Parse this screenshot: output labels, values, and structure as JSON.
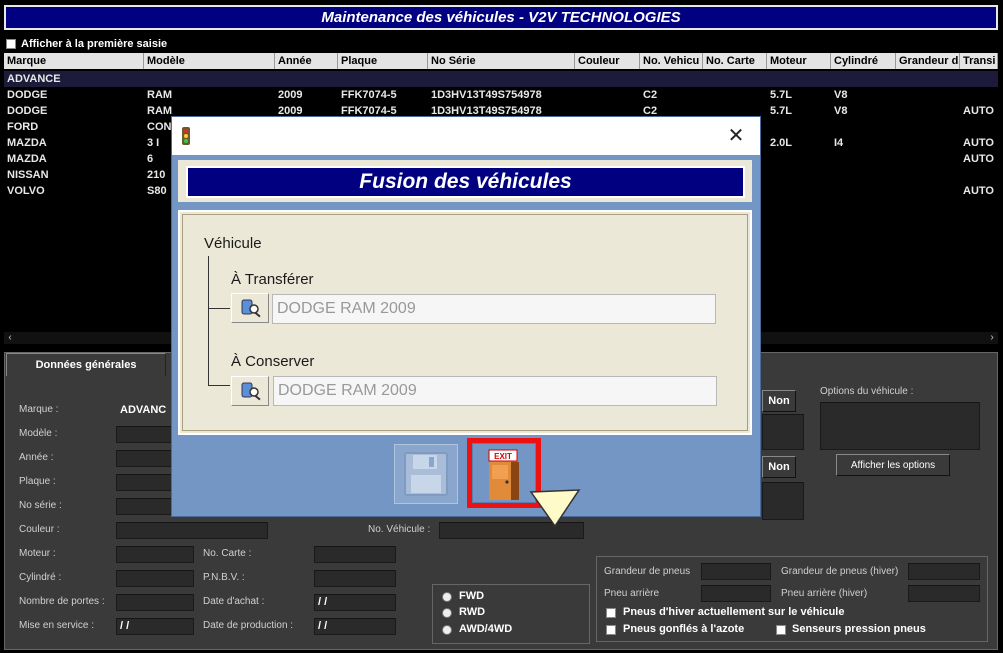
{
  "app": {
    "title": "Maintenance des véhicules - V2V TECHNOLOGIES"
  },
  "show_first": {
    "label": "Afficher à la première saisie"
  },
  "grid": {
    "columns": [
      "Marque",
      "Modèle",
      "Année",
      "Plaque",
      "No Série",
      "Couleur",
      "No. Vehicu",
      "No. Carte",
      "Moteur",
      "Cylindré",
      "Grandeur d",
      "Transi"
    ],
    "group": "ADVANCE",
    "rows": [
      [
        "DODGE",
        "RAM",
        "2009",
        "FFK7074-5",
        "1D3HV13T49S754978",
        "",
        "C2",
        "",
        "5.7L",
        "V8",
        "",
        ""
      ],
      [
        "DODGE",
        "RAM",
        "2009",
        "FFK7074-5",
        "1D3HV13T49S754978",
        "",
        "C2",
        "",
        "5.7L",
        "V8",
        "",
        "AUTO"
      ],
      [
        "FORD",
        "CON",
        "",
        "",
        "",
        "",
        "",
        "",
        "",
        "",
        "",
        ""
      ],
      [
        "MAZDA",
        "3 I",
        "",
        "",
        "",
        "",
        "",
        "",
        "2.0L",
        "I4",
        "",
        "AUTO"
      ],
      [
        "MAZDA",
        "6",
        "",
        "",
        "",
        "",
        "",
        "",
        "",
        "",
        "",
        "AUTO"
      ],
      [
        "NISSAN",
        "210",
        "",
        "",
        "",
        "",
        "",
        "",
        "",
        "",
        "",
        ""
      ],
      [
        "VOLVO",
        "S80",
        "",
        "",
        "",
        "",
        "",
        "",
        "",
        "",
        "",
        "AUTO"
      ]
    ]
  },
  "lower": {
    "tab": "Données générales",
    "labels": {
      "marque": "Marque :",
      "modele": "Modèle :",
      "annee": "Année :",
      "plaque": "Plaque :",
      "no_serie": "No série :",
      "couleur": "Couleur :",
      "no_vehicule": "No. Véhicule :",
      "moteur": "Moteur :",
      "no_carte": "No. Carte :",
      "cylindre": "Cylindré :",
      "pnbv": "P.N.B.V. :",
      "portes": "Nombre de portes :",
      "date_achat": "Date d'achat :",
      "mise_service": "Mise en service :",
      "date_production": "Date de production :",
      "options": "Options du véhicule :",
      "pneus": "Grandeur de pneus",
      "pneus_hiver": "Grandeur de pneus (hiver)",
      "pneu_arriere": "Pneu arrière",
      "pneu_arriere_hiver": "Pneu arrière (hiver)"
    },
    "values": {
      "marque": "ADVANC",
      "date_achat": "/ /",
      "mise_service": "/ /",
      "date_production": "/ /"
    },
    "non_1": "Non",
    "non_2": "Non",
    "show_options": "Afficher les options",
    "drive": [
      "FWD",
      "RWD",
      "AWD/4WD"
    ],
    "checks": [
      "Pneus d'hiver actuellement sur le véhicule",
      "Pneus gonflés à l'azote",
      "Senseurs pression pneus"
    ]
  },
  "dialog": {
    "banner": "Fusion des véhicules",
    "section": "Véhicule",
    "transfer_label": "À Transférer",
    "transfer_value": "DODGE RAM 2009",
    "keep_label": "À Conserver",
    "keep_value": "DODGE RAM 2009",
    "close_glyph": "✕",
    "exit_text": "EXIT"
  },
  "icons": {
    "app": "traffic-light-icon",
    "lookup": "search-vehicle-icon",
    "save": "floppy-disk-icon",
    "exit": "exit-door-icon",
    "cursor": "pointer-arrow-icon"
  }
}
